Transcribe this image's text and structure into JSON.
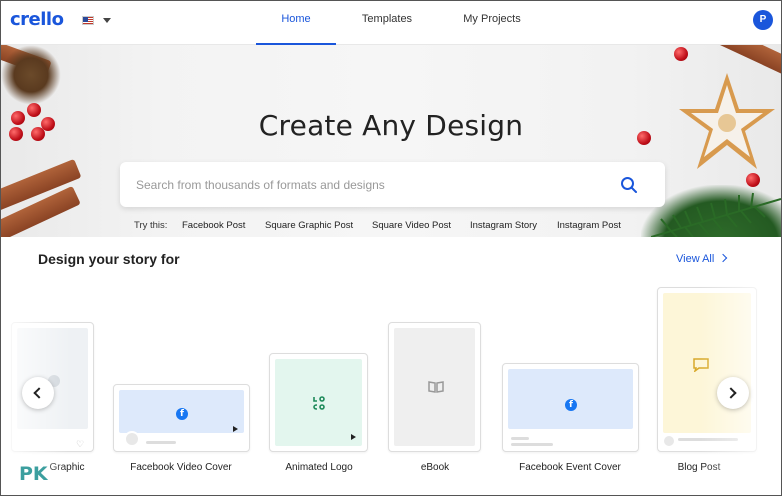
{
  "header": {
    "logo": "crello",
    "avatar_initial": "P",
    "tabs": [
      {
        "label": "Home",
        "active": true
      },
      {
        "label": "Templates",
        "active": false
      },
      {
        "label": "My Projects",
        "active": false
      }
    ]
  },
  "hero": {
    "title": "Create Any Design",
    "search_placeholder": "Search from thousands of formats and designs",
    "try_label": "Try this:",
    "try_links": [
      "Facebook Post",
      "Square Graphic Post",
      "Square Video Post",
      "Instagram Story",
      "Instagram Post"
    ]
  },
  "section": {
    "title": "Design your story for",
    "view_all": "View All"
  },
  "cards": [
    {
      "label": "Graphic",
      "icon": "instagram-icon"
    },
    {
      "label": "Facebook Video Cover",
      "icon": "facebook-icon"
    },
    {
      "label": "Animated Logo",
      "icon": "logo-icon"
    },
    {
      "label": "eBook",
      "icon": "book-icon"
    },
    {
      "label": "Facebook Event Cover",
      "icon": "facebook-icon"
    },
    {
      "label": "Blog Post",
      "icon": "comment-icon"
    }
  ],
  "watermark": "PK",
  "colors": {
    "accent": "#1a56db",
    "facebook": "#1877f2",
    "logo_green": "#1e8a5a"
  }
}
